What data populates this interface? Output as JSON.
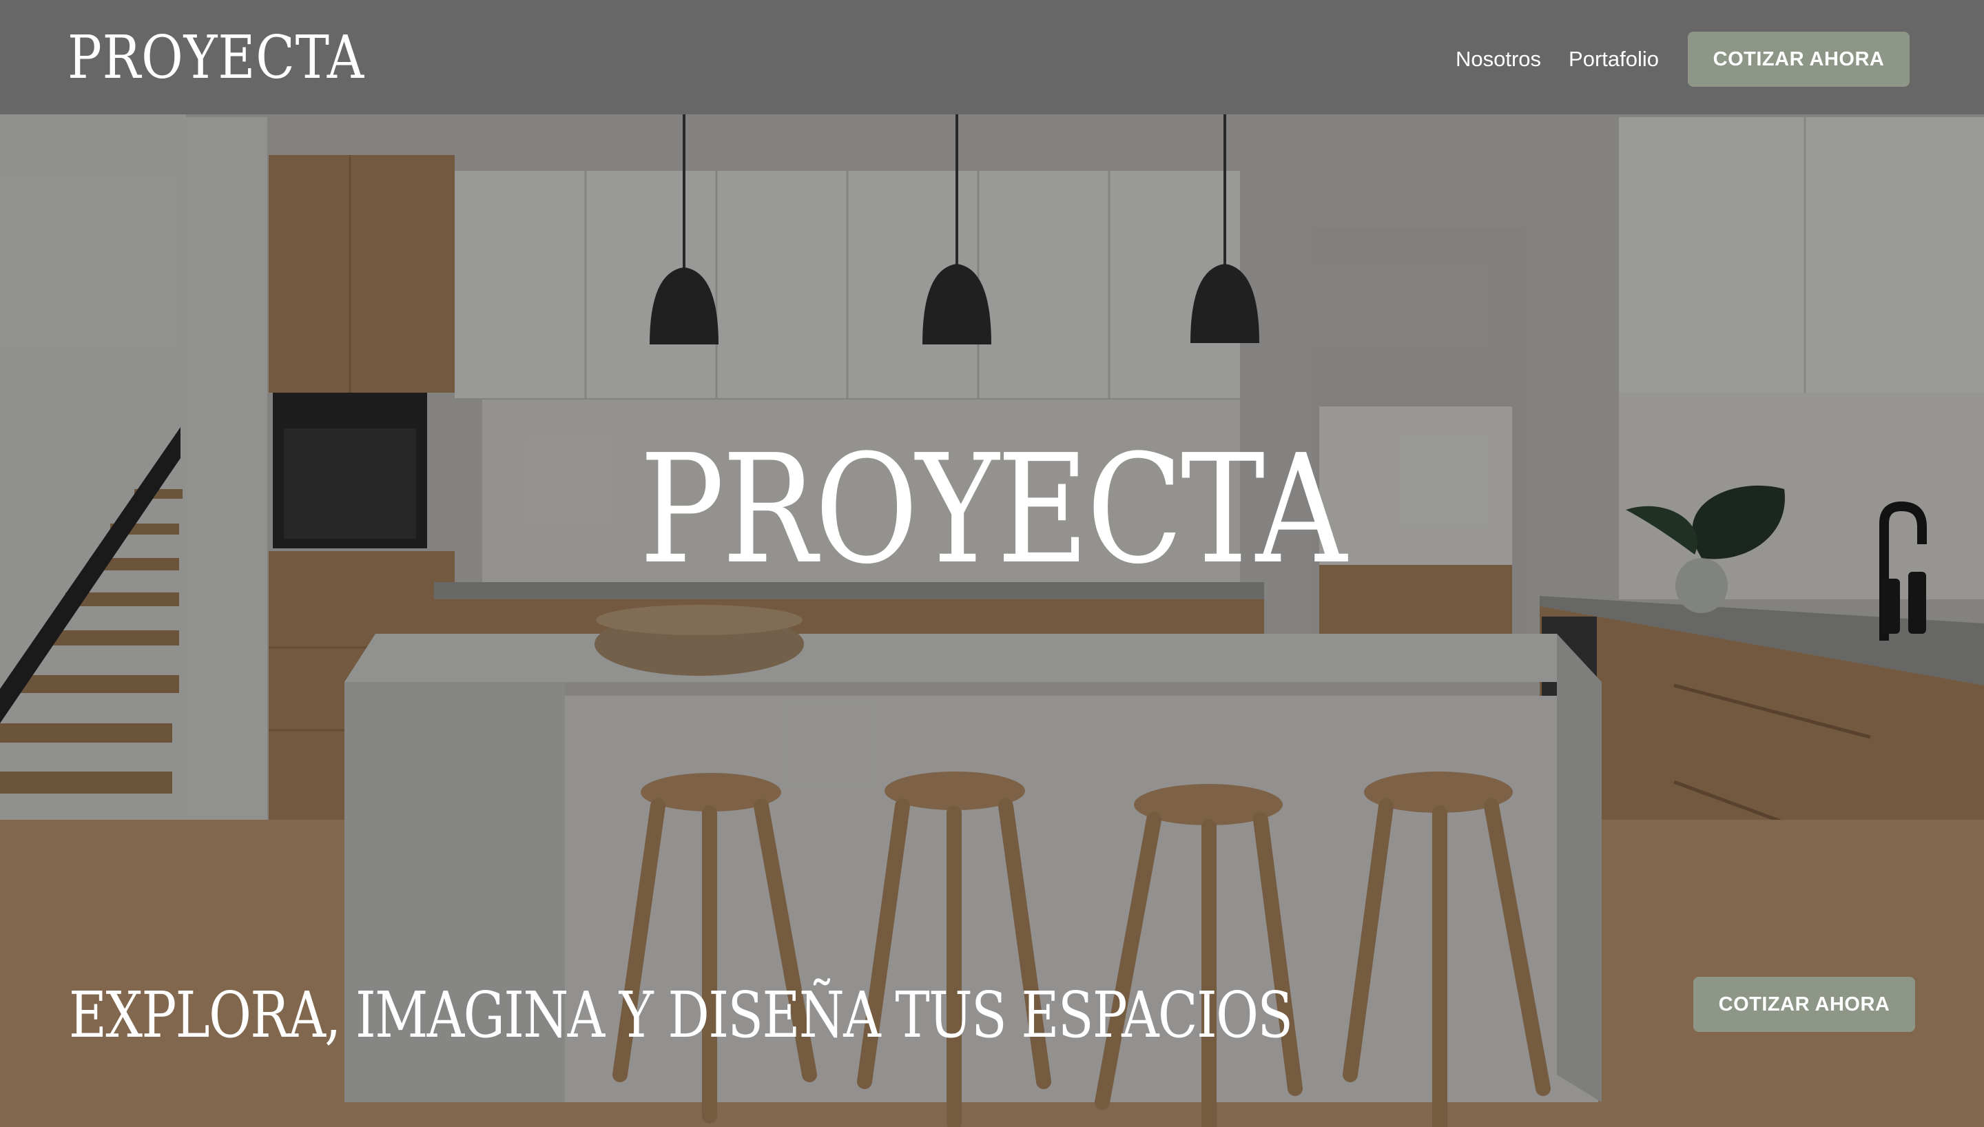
{
  "header": {
    "brand": "PROYECTA",
    "nav": [
      {
        "label": "Nosotros"
      },
      {
        "label": "Portafolio"
      }
    ],
    "cta_label": "COTIZAR AHORA"
  },
  "hero": {
    "title": "PROYECTA",
    "tagline": "EXPLORA, IMAGINA Y DISEÑA TUS ESPACIOS",
    "cta_label": "COTIZAR AHORA"
  },
  "colors": {
    "accent": "#8e9688",
    "header_bg": "#666666"
  }
}
